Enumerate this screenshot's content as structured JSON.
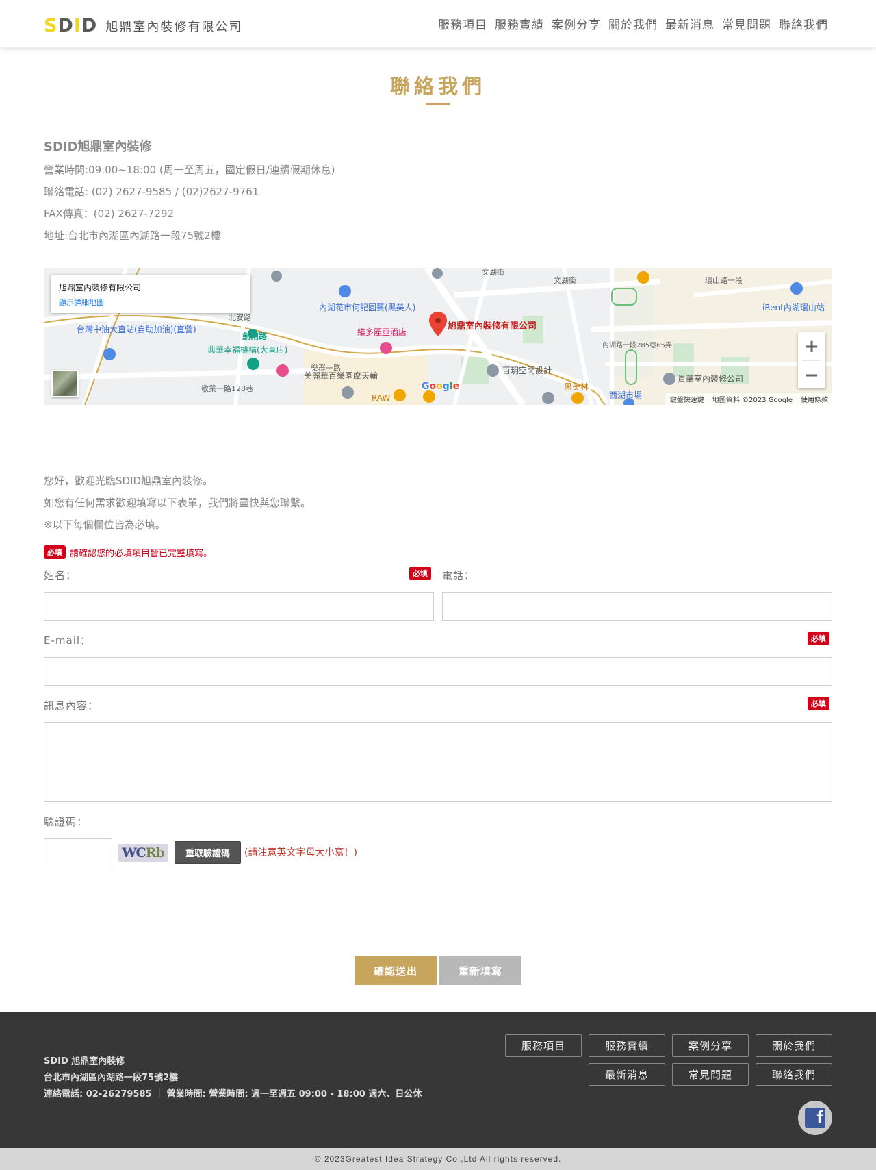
{
  "header": {
    "logo_mark": "SDID",
    "logo_text": "旭鼎室內裝修有限公司",
    "nav": [
      "服務項目",
      "服務實績",
      "案例分享",
      "關於我們",
      "最新消息",
      "常見問題",
      "聯絡我們"
    ]
  },
  "page": {
    "title": "聯絡我們"
  },
  "info": {
    "company": "SDID旭鼎室內裝修",
    "hours": "營業時間:09:00~18:00 (周一至周五，國定假日/連續假期休息)",
    "phone": "聯絡電話: (02) 2627-9585 / (02)2627-9761",
    "fax": "FAX傳真：(02) 2627-7292",
    "address": "地址:台北市內湖區內湖路一段75號2樓"
  },
  "map": {
    "card_title": "旭鼎室內裝修有限公司",
    "card_link": "顯示詳細地圖",
    "pin_label": "旭鼎室內裝修有限公司",
    "footer": [
      "鍵盤快速鍵",
      "地圖資料 ©2023 Google",
      "使用條款"
    ],
    "labels": [
      "劍南路",
      "內湖花市何記園藝(黑美人)",
      "維多麗亞酒店",
      "台灣中油大直站(自助加油)(直營)",
      "典華幸福機構(大直店)",
      "美麗華百樂園摩天輪",
      "百玥空間設計",
      "貴華室內裝修公司",
      "西湖市場",
      "黑美林",
      "RAW",
      "iRent內湖環山站",
      "文湖街",
      "環山路一段",
      "內湖路一段285巷65弄",
      "北安路",
      "敬業一路128巷",
      "樂群一路",
      "文湖街"
    ],
    "glogo": "Google",
    "zoom_in": "+",
    "zoom_out": "−"
  },
  "intro": {
    "line1": "您好，歡迎光臨SDID旭鼎室內裝修。",
    "line2": "如您有任何需求歡迎填寫以下表單，我們將盡快與您聯繫。",
    "line3": "※以下每個欄位皆為必填。"
  },
  "form": {
    "required_badge": "必填",
    "required_note": "請確認您的必填項目皆已完整填寫。",
    "name_label": "姓名：",
    "phone_label": "電話：",
    "email_label": "E-mail：",
    "message_label": "訊息內容：",
    "captcha_label": "驗證碼：",
    "captcha_text_a": "WC",
    "captcha_text_b": "Rb",
    "refresh_label": "重取驗證碼",
    "case_note": "(請注意英文字母大小寫！)",
    "submit_label": "確認送出",
    "reset_label": "重新填寫"
  },
  "footer": {
    "company": "SDID 旭鼎室內裝修",
    "address": "台北市內湖區內湖路一段75號2樓",
    "contact": "連絡電話: 02-26279585 ｜ 營業時間: 營業時間: 週一至週五 09:00 - 18:00 週六、日公休",
    "nav": [
      "服務項目",
      "服務實績",
      "案例分享",
      "關於我們",
      "最新消息",
      "常見問題",
      "聯絡我們"
    ],
    "fb": "f",
    "copyright": "© 2023Greatest Idea Strategy Co.,Ltd All rights reserved."
  }
}
